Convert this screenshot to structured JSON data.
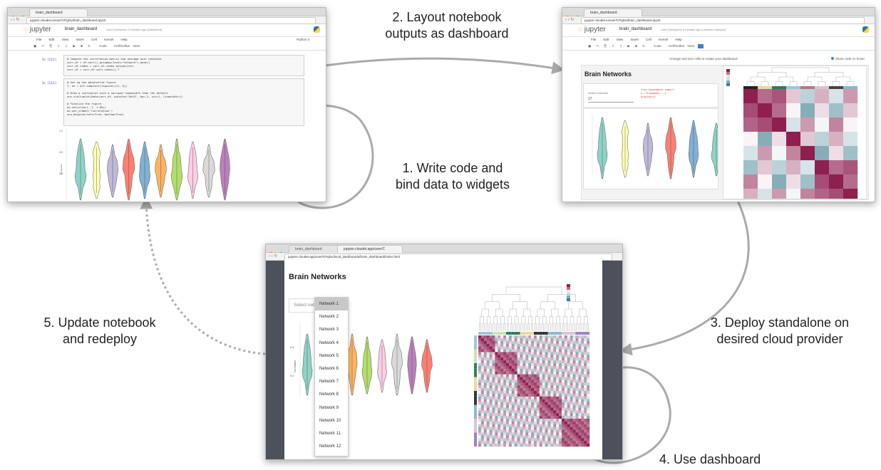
{
  "labels": {
    "step1": "1. Write code and\nbind data to widgets",
    "step2": "2. Layout notebook\noutputs as dashboard",
    "step3": "3. Deploy standalone on\ndesired cloud provider",
    "step4": "4. Use dashboard",
    "step5": "5. Update notebook\nand redeploy"
  },
  "notebook": {
    "tab_title": "brain_dashboard",
    "url": "jupyter.cloudet.io/user/CPgDu/brain_dashboard.ipynb",
    "logo": "jupyter",
    "name": "brain_dashboard",
    "checkpoint": "Last Checkpoint: 3 minutes ago (autosaved)",
    "kernel": "Python 3",
    "menus": [
      "File",
      "Edit",
      "View",
      "Insert",
      "Cell",
      "Kernel",
      "Help"
    ],
    "toolbar_text": "Code        CellToolbar   View:",
    "prompt1": "In [111]:",
    "prompt2": "In [112]:",
    "code1": "# Compute the correlation matrix and average over networks\ncorr_df = df.corr().groupby(level=\"network\").mean()\ncorr_df.index = corr_df.index.astype(int)\ncorr_df = corr_df.sort_index().T",
    "code2": "# Set up the matplotlib figure\nf, ax = plt.subplots(figsize=(11, 6))\n\n# Draw a violinplot with a narrower bandwidth than the default\nsns.violinplot(data=corr_df, palette=\"Set3\", bw=.2, cut=1, linewidth=1)\n\n# Finalize the figure\nax.set(ylim=(-.7, 1.05))\nax.set_ylabel('Correlation')\nsns.despine(left=True, bottom=True)"
  },
  "layout_view": {
    "tab_title": "brain_dashboard",
    "url": "jupyter.cloudet.io/user/CPgDu/brain_dashboard.ipynb",
    "name": "brain_dashboard",
    "checkpoint": "Last Checkpoint: 8 minutes ago (unsaved changes)",
    "hint": "Arrange and size cells to create your dashboard",
    "show_code": "Show code on hover",
    "dashboard_title": "Brain Networks",
    "select_label": "Select networks",
    "select_value": "17"
  },
  "dashboard": {
    "tab1": "brain_dashboard",
    "tab2": "jupyter.cloudet.app/user/C",
    "url": "jupyter.cloudet.app/user/CPgDu/local_dashboards/brain_dashboard/index.html",
    "title": "Brain Networks",
    "select_placeholder": "Select netw",
    "networks": [
      "Network 1",
      "Network 2",
      "Network 3",
      "Network 4",
      "Network 5",
      "Network 6",
      "Network 7",
      "Network 8",
      "Network 9",
      "Network 10",
      "Network 11",
      "Network 12"
    ]
  },
  "colors": {
    "violins": [
      "#8dd3c7",
      "#ffffb3",
      "#bebada",
      "#fb8072",
      "#80b1d3",
      "#fdb462",
      "#b3de69",
      "#fccde5",
      "#d9d9d9",
      "#bc80bd"
    ],
    "arrow": "#aaaaaa",
    "heat_high": "#8e1f4f",
    "heat_low": "#3d7f8f"
  }
}
